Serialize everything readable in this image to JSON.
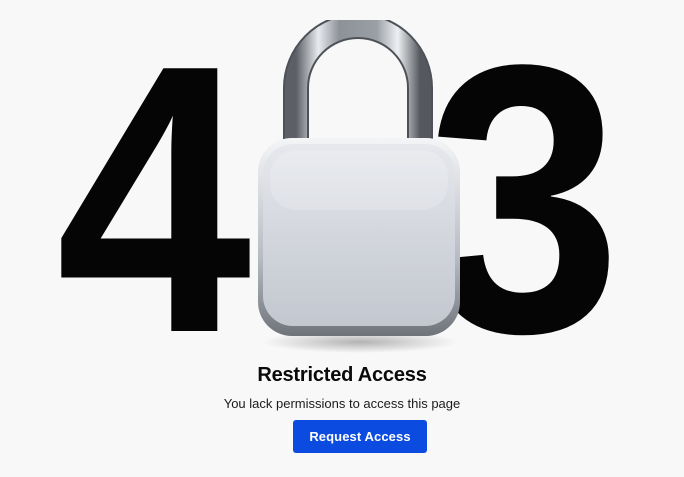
{
  "error": {
    "code_left": "4",
    "code_right": "3",
    "lock_icon": "padlock-icon"
  },
  "message": {
    "title": "Restricted Access",
    "subtitle": "You lack permissions to access this page"
  },
  "actions": {
    "request_label": "Request Access"
  },
  "colors": {
    "background": "#f8f8f8",
    "digits": "#050505",
    "button": "#0b4be0",
    "button_text": "#ffffff"
  }
}
